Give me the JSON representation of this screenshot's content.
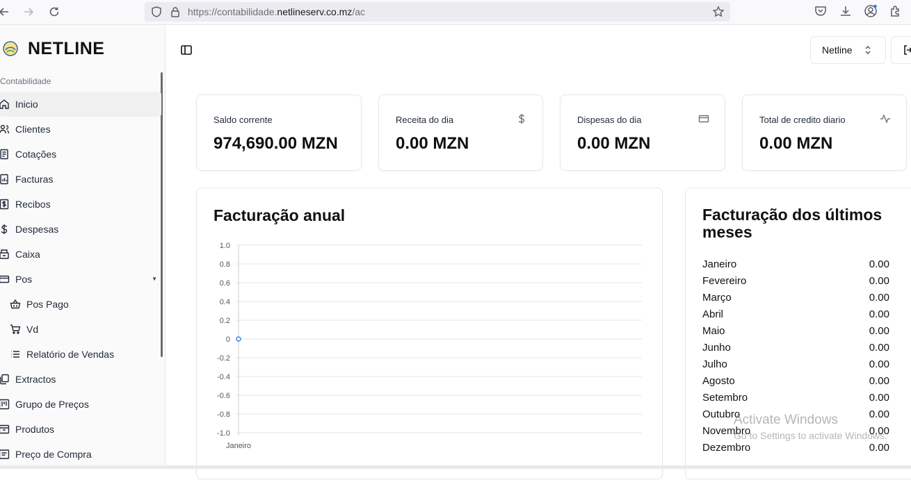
{
  "browser": {
    "url_prefix": "https://contabilidade.",
    "url_host": "netlineserv.co.mz",
    "url_suffix": "/ac"
  },
  "sidebar": {
    "brand": "NETLINE",
    "group_label": "Contabilidade",
    "items": [
      {
        "label": "Inicio",
        "icon": "home-icon"
      },
      {
        "label": "Clientes",
        "icon": "users-icon"
      },
      {
        "label": "Cotações",
        "icon": "document-icon"
      },
      {
        "label": "Facturas",
        "icon": "invoice-icon"
      },
      {
        "label": "Recibos",
        "icon": "receipt-icon"
      },
      {
        "label": "Despesas",
        "icon": "dollar-icon"
      },
      {
        "label": "Caixa",
        "icon": "cash-register-icon"
      },
      {
        "label": "Pos",
        "icon": "card-icon"
      },
      {
        "label": "Pos Pago",
        "icon": "basket-icon"
      },
      {
        "label": "Vd",
        "icon": "cart-icon"
      },
      {
        "label": "Relatório de Vendas",
        "icon": "list-icon"
      },
      {
        "label": "Extractos",
        "icon": "copy-icon"
      },
      {
        "label": "Grupo de Preços",
        "icon": "kanban-icon"
      },
      {
        "label": "Produtos",
        "icon": "package-icon"
      },
      {
        "label": "Preço de Compra",
        "icon": "tag-icon"
      }
    ]
  },
  "header": {
    "org_select": "Netline"
  },
  "stats": [
    {
      "title": "Saldo corrente",
      "value": "974,690.00 MZN",
      "icon": ""
    },
    {
      "title": "Receita do dia",
      "value": "0.00 MZN",
      "icon": "dollar-icon"
    },
    {
      "title": "Dispesas do dia",
      "value": "0.00 MZN",
      "icon": "credit-card-icon"
    },
    {
      "title": "Total de credito diario",
      "value": "0.00 MZN",
      "icon": "activity-icon"
    }
  ],
  "annual_chart": {
    "title": "Facturação anual"
  },
  "chart_data": {
    "type": "line",
    "title": "Facturação anual",
    "categories": [
      "Janeiro"
    ],
    "series": [
      {
        "values": [
          0
        ]
      }
    ],
    "ylim": [
      -1.0,
      1.0
    ],
    "yticks": [
      "1.0",
      "0.8",
      "0.6",
      "0.4",
      "0.2",
      "0",
      "-0.2",
      "-0.4",
      "-0.6",
      "-0.8",
      "-1.0"
    ],
    "grid": true,
    "point_color": "#3b82f6"
  },
  "recent": {
    "title": "Facturação dos últimos meses",
    "months": [
      {
        "name": "Janeiro",
        "value": "0.00"
      },
      {
        "name": "Fevereiro",
        "value": "0.00"
      },
      {
        "name": "Março",
        "value": "0.00"
      },
      {
        "name": "Abril",
        "value": "0.00"
      },
      {
        "name": "Maio",
        "value": "0.00"
      },
      {
        "name": "Junho",
        "value": "0.00"
      },
      {
        "name": "Julho",
        "value": "0.00"
      },
      {
        "name": "Agosto",
        "value": "0.00"
      },
      {
        "name": "Setembro",
        "value": "0.00"
      },
      {
        "name": "Outubro",
        "value": "0.00"
      },
      {
        "name": "Novembro",
        "value": "0.00"
      },
      {
        "name": "Dezembro",
        "value": "0.00"
      }
    ]
  },
  "watermark": {
    "line1": "Activate Windows",
    "line2": "Go to Settings to activate Windows."
  }
}
